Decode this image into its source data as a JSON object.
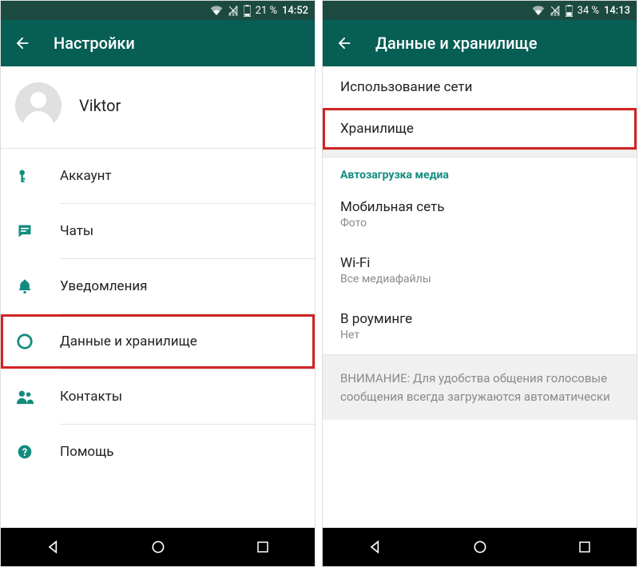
{
  "left": {
    "status": {
      "battery": "21 %",
      "time": "14:52"
    },
    "appbar": {
      "title": "Настройки"
    },
    "profile": {
      "name": "Viktor"
    },
    "menu": {
      "account": "Аккаунт",
      "chats": "Чаты",
      "notifications": "Уведомления",
      "data": "Данные и хранилище",
      "contacts": "Контакты",
      "help": "Помощь"
    }
  },
  "right": {
    "status": {
      "battery": "34 %",
      "time": "14:13"
    },
    "appbar": {
      "title": "Данные и хранилище"
    },
    "items": {
      "network_usage": "Использование сети",
      "storage": "Хранилище",
      "section_media": "Автозагрузка медиа",
      "mobile": {
        "title": "Мобильная сеть",
        "sub": "Фото"
      },
      "wifi": {
        "title": "Wi-Fi",
        "sub": "Все медиафайлы"
      },
      "roaming": {
        "title": "В роуминге",
        "sub": "Нет"
      },
      "notice": "ВНИМАНИЕ: Для удобства общения голосовые сообщения всегда загружаются автоматически"
    }
  }
}
